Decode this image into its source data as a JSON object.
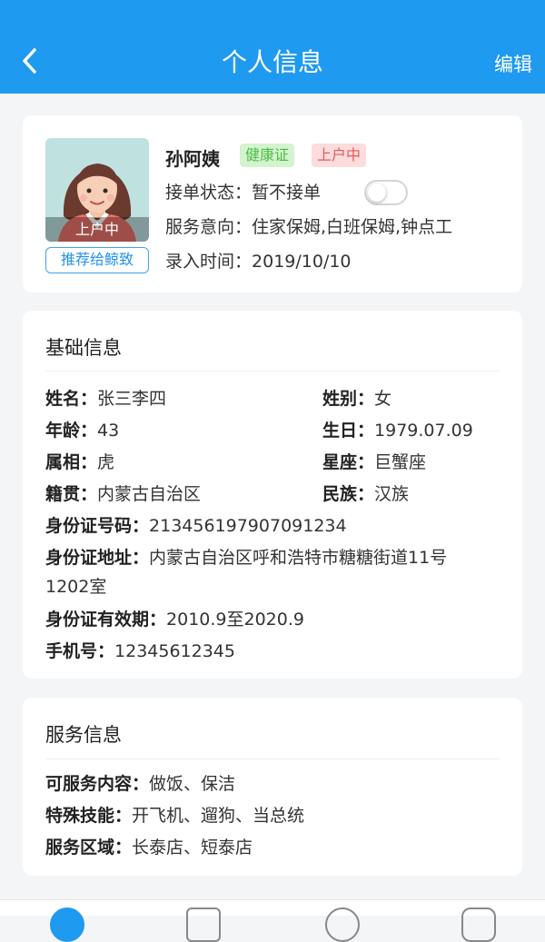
{
  "nav": {
    "title": "个人信息",
    "edit_label": "编辑"
  },
  "profile": {
    "name": "孙阿姨",
    "tags": {
      "health": "健康证",
      "status": "上户中"
    },
    "avatar_badge": "上户中",
    "recommend_label": "推荐给鲸致",
    "order_status_label": "接单状态：",
    "order_status_value": "暂不接单",
    "order_toggle_on": false,
    "intent_label": "服务意向：",
    "intent_value": "住家保姆,白班保姆,钟点工",
    "date_label": "录入时间：",
    "date_value": "2019/10/10"
  },
  "basic": {
    "title": "基础信息",
    "name_label": "姓名：",
    "name_value": "张三李四",
    "gender_label": "姓别：",
    "gender_value": "女",
    "age_label": "年龄：",
    "age_value": "43",
    "birthday_label": "生日：",
    "birthday_value": "1979.07.09",
    "zodiac_label": "属相：",
    "zodiac_value": "虎",
    "constellation_label": "星座：",
    "constellation_value": "巨蟹座",
    "native_label": "籍贯：",
    "native_value": "内蒙古自治区",
    "ethnic_label": "民族：",
    "ethnic_value": "汉族",
    "id_label": "身份证号码：",
    "id_value": "213456197907091234",
    "address_label": "身份证地址：",
    "address_value_line1": "内蒙古自治区呼和浩特市糖糖街道11号",
    "address_value_line2": "1202室",
    "validity_label": "身份证有效期：",
    "validity_value": "2010.9至2020.9",
    "phone_label": "手机号：",
    "phone_value": "12345612345"
  },
  "service": {
    "title": "服务信息",
    "content_label": "可服务内容：",
    "content_value": "做饭、保洁",
    "skills_label": "特殊技能：",
    "skills_value": "开飞机、遛狗、当总统",
    "area_label": "服务区域：",
    "area_value": "长泰店、短泰店"
  },
  "colors": {
    "primary": "#1e9af0",
    "health_tag": "#4bbd41",
    "status_tag": "#e55a5a"
  }
}
